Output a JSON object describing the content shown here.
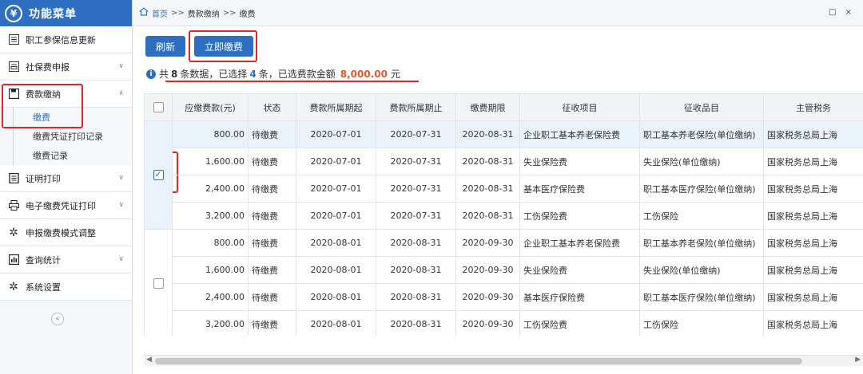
{
  "sidebar": {
    "title": "功能菜单",
    "logo_char": "¥",
    "items": [
      {
        "label": "职工参保信息更新",
        "icon": "list-icon",
        "has_chevron": false
      },
      {
        "label": "社保费申报",
        "icon": "form-icon",
        "has_chevron": true,
        "chevron": "∨"
      },
      {
        "label": "费款缴纳",
        "icon": "save-icon",
        "has_chevron": true,
        "chevron": "∧"
      }
    ],
    "subitems": [
      "缴费",
      "缴费凭证打印记录",
      "缴费记录"
    ],
    "items2": [
      {
        "label": "证明打印",
        "icon": "doc-icon",
        "chevron": "∨"
      },
      {
        "label": "电子缴费凭证打印",
        "icon": "printer-icon",
        "chevron": "∨"
      },
      {
        "label": "申报缴费模式调整",
        "icon": "gear-icon",
        "chevron": ""
      },
      {
        "label": "查询统计",
        "icon": "chart-icon",
        "chevron": "∨"
      },
      {
        "label": "系统设置",
        "icon": "gear-icon",
        "chevron": ""
      }
    ],
    "collapse": "«"
  },
  "breadcrumb": {
    "home": "首页",
    "sep": ">>",
    "level1": "费款缴纳",
    "level2": "缴费",
    "window_controls": "□ ×"
  },
  "toolbar": {
    "refresh": "刷新",
    "pay_now": "立即缴费"
  },
  "info": {
    "prefix": "共",
    "total": "8",
    "mid1": "条数据，已选择",
    "selected": "4",
    "mid2": "条，已选费款金额",
    "amount": "8,000.00",
    "unit": "元"
  },
  "table": {
    "headers": [
      "应缴费款(元)",
      "状态",
      "费款所属期起",
      "费款所属期止",
      "缴费期限",
      "征收项目",
      "征收品目",
      "主管税务"
    ],
    "rows": [
      [
        "800.00",
        "待缴费",
        "2020-07-01",
        "2020-07-31",
        "2020-08-31",
        "企业职工基本养老保险费",
        "职工基本养老保险(单位缴纳)",
        "国家税务总局上海"
      ],
      [
        "1,600.00",
        "待缴费",
        "2020-07-01",
        "2020-07-31",
        "2020-08-31",
        "失业保险费",
        "失业保险(单位缴纳)",
        "国家税务总局上海"
      ],
      [
        "2,400.00",
        "待缴费",
        "2020-07-01",
        "2020-07-31",
        "2020-08-31",
        "基本医疗保险费",
        "职工基本医疗保险(单位缴纳)",
        "国家税务总局上海"
      ],
      [
        "3,200.00",
        "待缴费",
        "2020-07-01",
        "2020-07-31",
        "2020-08-31",
        "工伤保险费",
        "工伤保险",
        "国家税务总局上海"
      ],
      [
        "800.00",
        "待缴费",
        "2020-08-01",
        "2020-08-31",
        "2020-09-30",
        "企业职工基本养老保险费",
        "职工基本养老保险(单位缴纳)",
        "国家税务总局上海"
      ],
      [
        "1,600.00",
        "待缴费",
        "2020-08-01",
        "2020-08-31",
        "2020-09-30",
        "失业保险费",
        "失业保险(单位缴纳)",
        "国家税务总局上海"
      ],
      [
        "2,400.00",
        "待缴费",
        "2020-08-01",
        "2020-08-31",
        "2020-09-30",
        "基本医疗保险费",
        "职工基本医疗保险(单位缴纳)",
        "国家税务总局上海"
      ],
      [
        "3,200.00",
        "待缴费",
        "2020-08-01",
        "2020-08-31",
        "2020-09-30",
        "工伤保险费",
        "工伤保险",
        "国家税务总局上海"
      ]
    ]
  },
  "colors": {
    "primary": "#2f6fc1",
    "highlight": "#e3262b",
    "amount": "#e2572a"
  }
}
